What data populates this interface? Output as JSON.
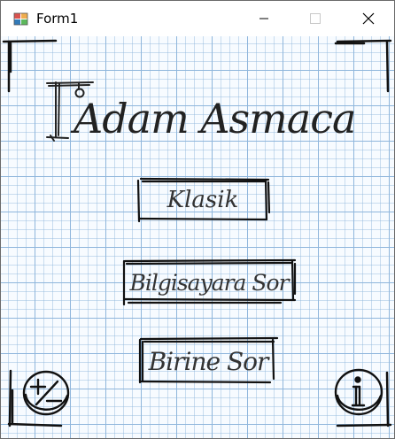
{
  "window": {
    "title": "Form1",
    "controls": {
      "minimize_icon": "minimize-icon",
      "maximize_icon": "maximize-icon",
      "close_icon": "close-icon"
    }
  },
  "main": {
    "heading": "Adam Asmaca",
    "buttons": {
      "klasik": "Klasik",
      "bilgisayara_sor": "Bilgisayara Sor",
      "birine_sor": "Birine Sor"
    },
    "settings_icon": "plus-minus-icon",
    "info_icon": "info-icon"
  },
  "colors": {
    "grid_line": "#8fb6dc",
    "paper": "#f7fbff",
    "ink": "#222222"
  }
}
